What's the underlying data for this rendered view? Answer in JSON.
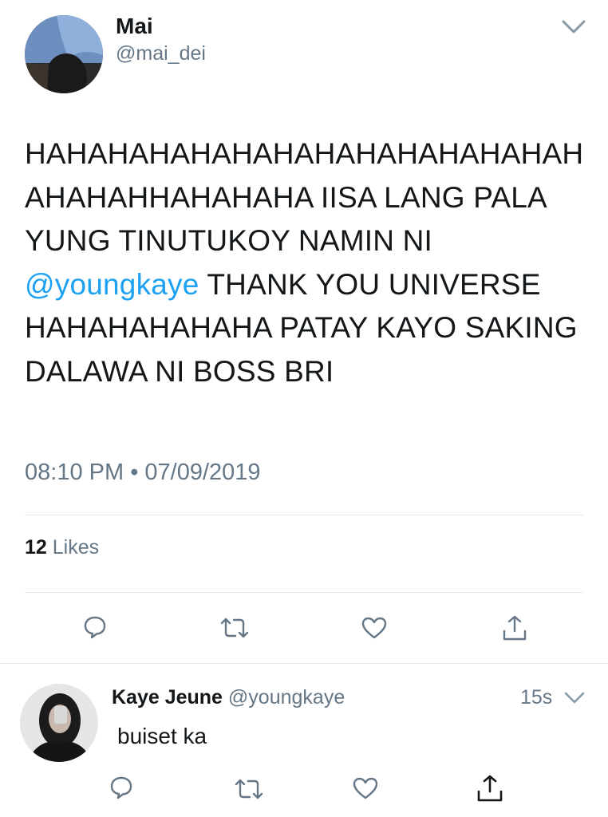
{
  "tweet": {
    "author_name": "Mai",
    "author_handle": "@mai_dei",
    "text_before": "HAHAHAHAHAHAHAHAHAHAHAHAHAH AHAHAHHAHAHAHA IISA LANG PALA YUNG TINUTUKOY NAMIN NI ",
    "mention": "@youngkaye",
    "text_after": " THANK YOU UNIVERSE HAHAHAHAHAHA PATAY KAYO SAKING DALAWA NI BOSS BRI",
    "time": "08:10 PM",
    "separator": "•",
    "date": "07/09/2019",
    "likes_count": "12",
    "likes_label": "Likes",
    "icons": [
      "reply-icon",
      "retweet-icon",
      "like-icon",
      "share-icon"
    ]
  },
  "reply": {
    "author_name": "Kaye Jeune",
    "author_handle": "@youngkaye",
    "age": "15s",
    "text": "buiset ka",
    "icons": [
      "reply-icon",
      "retweet-icon",
      "like-icon",
      "share-icon"
    ]
  },
  "colors": {
    "text": "#14171a",
    "secondary": "#657786",
    "link": "#1da1f2",
    "divider": "#e1e8ed"
  }
}
